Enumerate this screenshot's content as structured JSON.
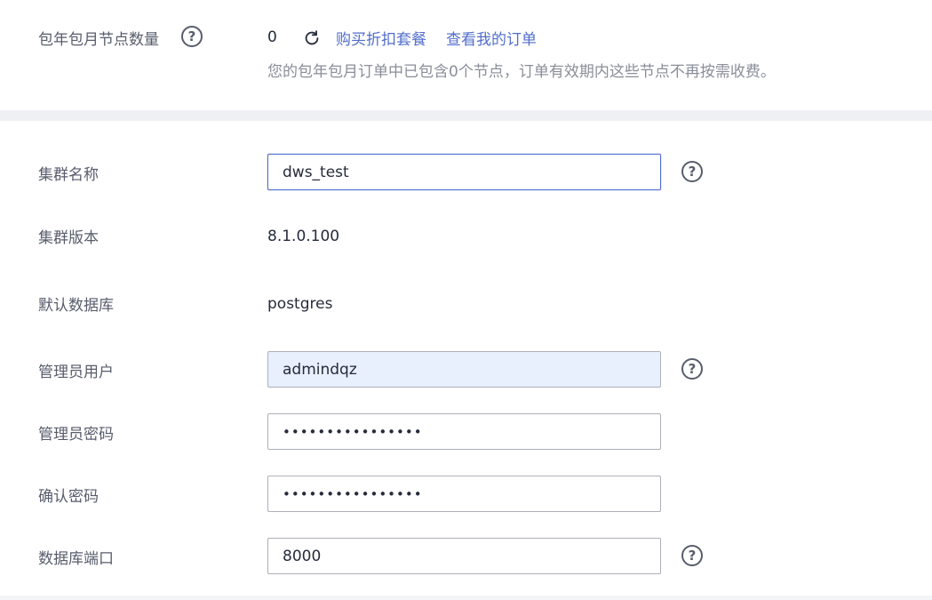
{
  "top": {
    "label": "包年包月节点数量",
    "value": "0",
    "buy_link": "购买折扣套餐",
    "orders_link": "查看我的订单",
    "hint": "您的包年包月订单中已包含0个节点，订单有效期内这些节点不再按需收费。"
  },
  "form": {
    "cluster_name": {
      "label": "集群名称",
      "value": "dws_test"
    },
    "cluster_version": {
      "label": "集群版本",
      "value": "8.1.0.100"
    },
    "default_db": {
      "label": "默认数据库",
      "value": "postgres"
    },
    "admin_user": {
      "label": "管理员用户",
      "value": "admindqz"
    },
    "admin_password": {
      "label": "管理员密码",
      "value": "••••••••••••••••"
    },
    "confirm_password": {
      "label": "确认密码",
      "value": "••••••••••••••••"
    },
    "db_port": {
      "label": "数据库端口",
      "value": "8000"
    }
  },
  "help_glyph": "?",
  "icons": [
    "help-icon",
    "refresh-icon"
  ],
  "colors": {
    "link": "#526ecc",
    "autofill_bg": "#e8effd",
    "label": "#575d6c",
    "hint": "#8a8e99"
  }
}
